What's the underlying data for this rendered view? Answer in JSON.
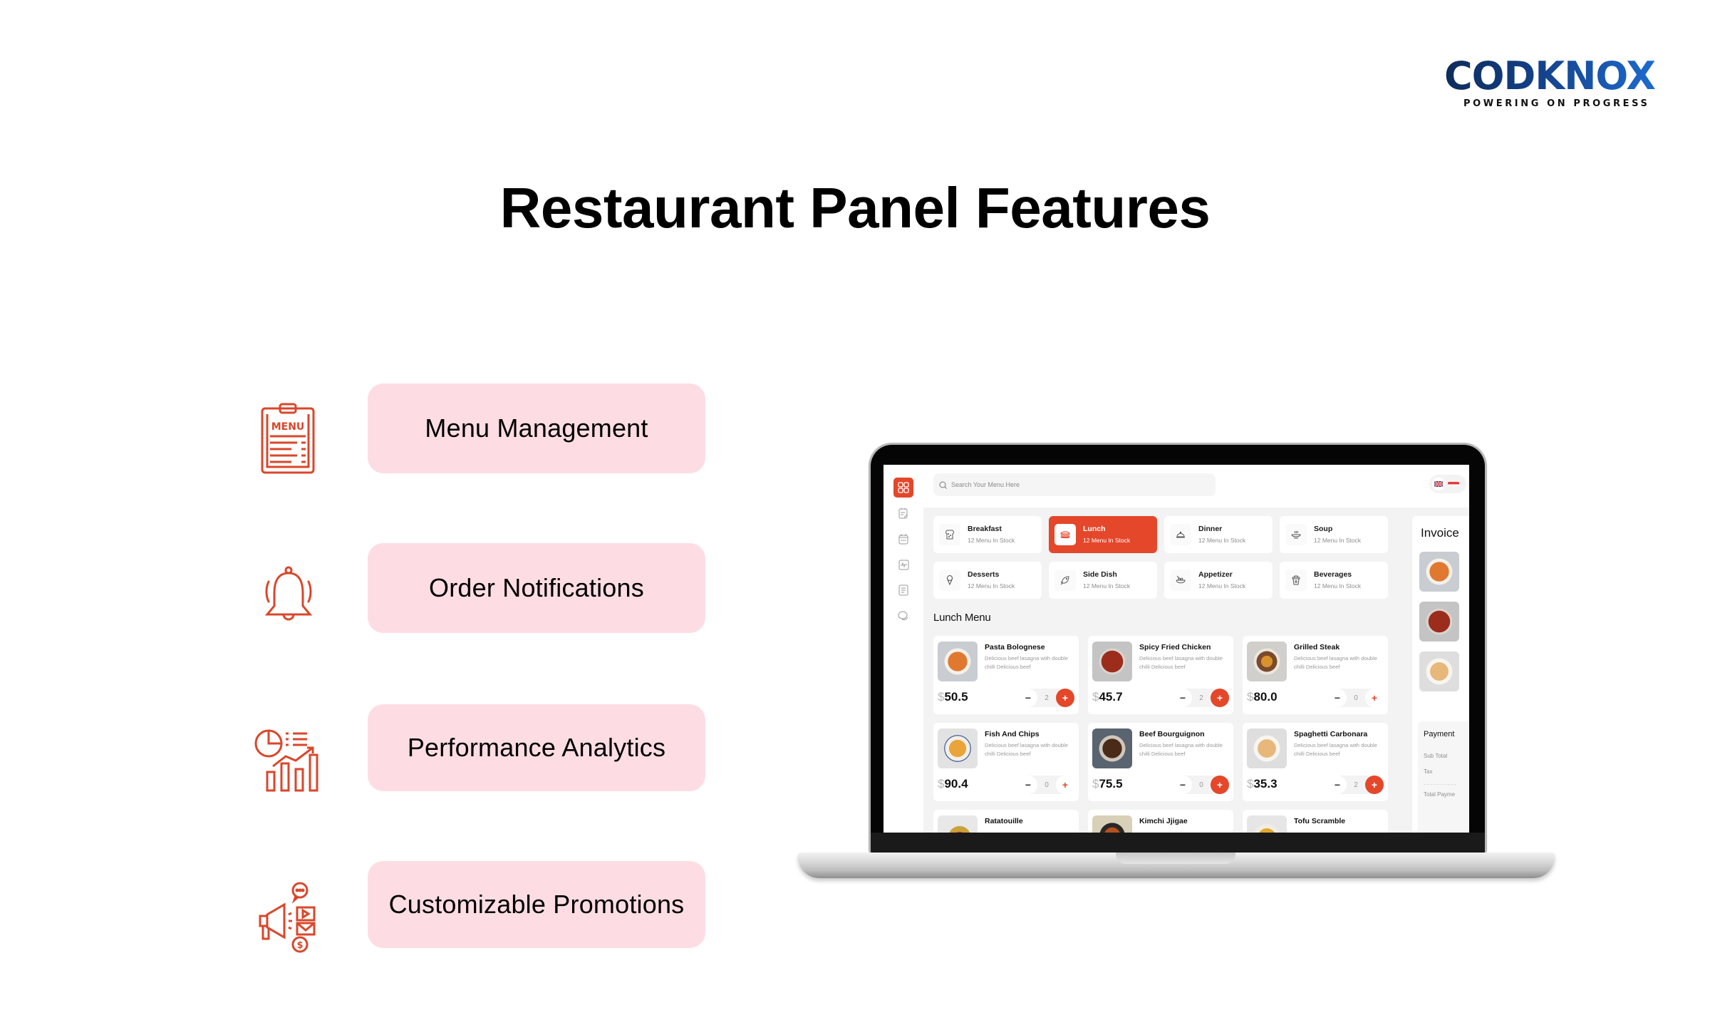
{
  "brand": {
    "logo_text": "CODKNOX",
    "tagline": "POWERING ON PROGRESS",
    "colors": {
      "logo_dark": "#0c2a55",
      "logo_light": "#1e6fd6"
    }
  },
  "page": {
    "title": "Restaurant Panel Features",
    "accent_color": "#e4472a",
    "pill_color": "#fddde3"
  },
  "features": [
    {
      "label": "Menu Management",
      "icon": "menu-clipboard-icon"
    },
    {
      "label": "Order Notifications",
      "icon": "bell-icon"
    },
    {
      "label": "Performance Analytics",
      "icon": "analytics-chart-icon"
    },
    {
      "label": "Customizable Promotions",
      "icon": "megaphone-promotion-icon"
    }
  ],
  "app": {
    "sidebar": [
      {
        "icon": "dashboard-grid-icon",
        "active": true
      },
      {
        "icon": "notes-edit-icon"
      },
      {
        "icon": "calendar-icon"
      },
      {
        "icon": "activity-chart-icon"
      },
      {
        "icon": "document-icon"
      },
      {
        "icon": "chat-bubble-icon"
      }
    ],
    "search": {
      "placeholder": "Search Your Menu Here"
    },
    "languages": [
      "en-uk-flag",
      "id-flag"
    ],
    "categories": [
      {
        "name": "Breakfast",
        "stock": "12 Menu In Stock",
        "icon": "bread-icon"
      },
      {
        "name": "Lunch",
        "stock": "12 Menu In Stock",
        "icon": "burger-icon",
        "active": true
      },
      {
        "name": "Dinner",
        "stock": "12 Menu In Stock",
        "icon": "cloche-icon"
      },
      {
        "name": "Soup",
        "stock": "12 Menu In Stock",
        "icon": "soup-bowl-icon"
      },
      {
        "name": "Desserts",
        "stock": "12 Menu In Stock",
        "icon": "ice-cream-icon"
      },
      {
        "name": "Side Dish",
        "stock": "12 Menu In Stock",
        "icon": "fish-icon"
      },
      {
        "name": "Appetizer",
        "stock": "12 Menu In Stock",
        "icon": "salad-bowl-icon"
      },
      {
        "name": "Beverages",
        "stock": "12 Menu In Stock",
        "icon": "cup-icon"
      }
    ],
    "menu_title": "Lunch Menu",
    "dishes": [
      {
        "name": "Pasta Bolognese",
        "desc": "Delicious beef lasagna with double chilli Delicious beef",
        "currency": "$",
        "price": "50.5",
        "qty": "2",
        "image": "pasta"
      },
      {
        "name": "Spicy Fried Chicken",
        "desc": "Delicious beef lasagna with double chilli Delicious beef",
        "currency": "$",
        "price": "45.7",
        "qty": "2",
        "image": "chicken"
      },
      {
        "name": "Grilled Steak",
        "desc": "Delicious beef lasagna with double chilli Delicious beef",
        "currency": "$",
        "price": "80.0",
        "qty": "0",
        "image": "steak"
      },
      {
        "name": "Fish And Chips",
        "desc": "Delicious beef lasagna with double chilli Delicious beef",
        "currency": "$",
        "price": "90.4",
        "qty": "0",
        "image": "fish"
      },
      {
        "name": "Beef Bourguignon",
        "desc": "Delicious beef lasagna with double chilli Delicious beef",
        "currency": "$",
        "price": "75.5",
        "qty": "0",
        "image": "beef"
      },
      {
        "name": "Spaghetti Carbonara",
        "desc": "Delicious beef lasagna with double chilli Delicious beef",
        "currency": "$",
        "price": "35.3",
        "qty": "2",
        "image": "carbonara"
      },
      {
        "name": "Ratatouille",
        "image": "ratatouille"
      },
      {
        "name": "Kimchi Jjigae",
        "image": "kimchi"
      },
      {
        "name": "Tofu Scramble",
        "image": "tofu"
      }
    ],
    "invoice": {
      "title": "Invoice",
      "payment_title": "Payment",
      "sub_total_label": "Sub Total",
      "tax_label": "Tax",
      "total_label": "Total Payme"
    }
  }
}
